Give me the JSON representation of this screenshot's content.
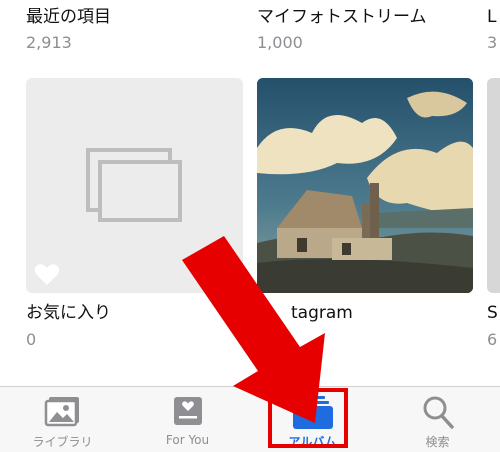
{
  "albums": [
    {
      "title": "最近の項目",
      "count": "2,913"
    },
    {
      "title": "マイフォトストリーム",
      "count": "1,000"
    },
    {
      "title": "L",
      "count": "3"
    },
    {
      "title": "お気に入り",
      "count": "0"
    },
    {
      "title": "tagram",
      "count": ""
    },
    {
      "title": "S",
      "count": "6"
    }
  ],
  "tabs": [
    {
      "label": "ライブラリ",
      "icon": "photos-icon"
    },
    {
      "label": "For You",
      "icon": "for-you-icon"
    },
    {
      "label": "アルバム",
      "icon": "albums-icon",
      "active": true
    },
    {
      "label": "検索",
      "icon": "search-icon"
    }
  ],
  "colors": {
    "accent": "#1f6be0",
    "annotation": "#e60000"
  }
}
